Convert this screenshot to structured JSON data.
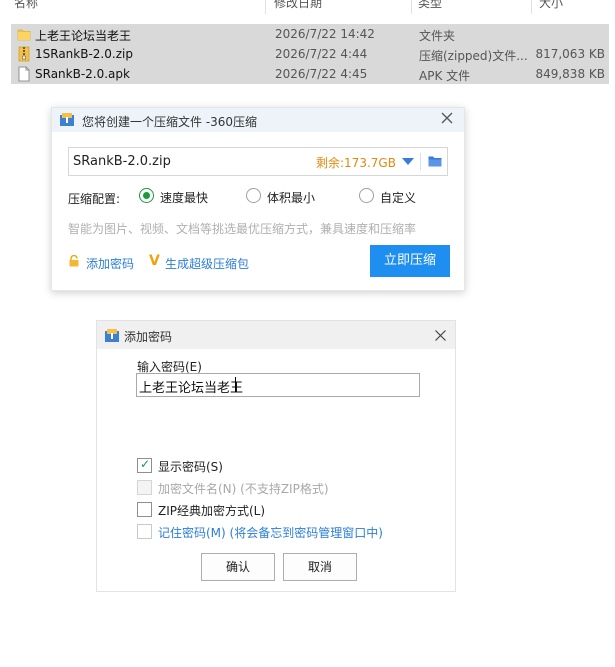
{
  "explorer": {
    "columns": {
      "name": "名称",
      "date": "修改日期",
      "type": "类型",
      "size": "大小"
    },
    "rows": [
      {
        "name": "上老王论坛当老王",
        "date": "2026/7/22 14:42",
        "type": "文件夹",
        "size": "",
        "icon": "folder-icon",
        "selected": true
      },
      {
        "name": "1SRankB-2.0.zip",
        "date": "2026/7/22 4:44",
        "type": "压缩(zipped)文件...",
        "size": "817,063 KB",
        "icon": "zip-file-icon",
        "selected": true
      },
      {
        "name": "SRankB-2.0.apk",
        "date": "2026/7/22 4:45",
        "type": "APK 文件",
        "size": "849,838 KB",
        "icon": "file-icon",
        "selected": true
      }
    ]
  },
  "compress_dialog": {
    "title": "您将创建一个压缩文件 -360压缩",
    "filename": "SRankB-2.0.zip",
    "remaining": "剩余:173.7GB",
    "config_label": "压缩配置:",
    "options": [
      "速度最快",
      "体积最小",
      "自定义"
    ],
    "selected_option": "速度最快",
    "description": "智能为图片、视频、文档等挑选最优压缩方式，兼具速度和压缩率",
    "add_password_link": "添加密码",
    "super_package_link": "生成超级压缩包",
    "compress_button": "立即压缩",
    "accent_color": "#1e8ef0"
  },
  "password_dialog": {
    "title": "添加密码",
    "input_label": "输入密码(E)",
    "password_value": "上老王论坛当老王",
    "show_password": {
      "label": "显示密码(S)",
      "checked": true
    },
    "encrypt_filename": {
      "label": "加密文件名(N) (不支持ZIP格式)",
      "checked": false,
      "disabled": true
    },
    "zip_classic": {
      "label": "ZIP经典加密方式(L)",
      "checked": false
    },
    "remember_password": {
      "label": "记住密码(M) (将会备忘到密码管理窗口中)",
      "checked": false
    },
    "ok_button": "确认",
    "cancel_button": "取消"
  }
}
